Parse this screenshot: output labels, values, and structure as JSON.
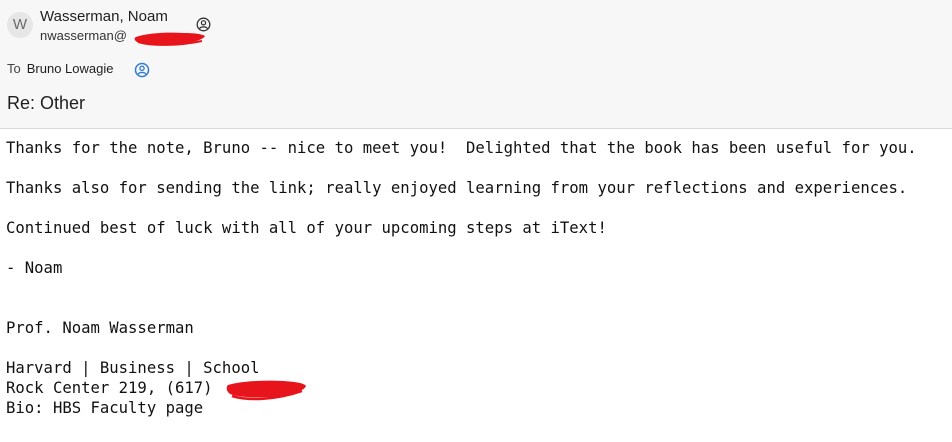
{
  "sender": {
    "avatar_initial": "W",
    "name": "Wasserman, Noam",
    "email_prefix": "nwasserman@"
  },
  "recipient": {
    "to_label": "To",
    "name": "Bruno Lowagie"
  },
  "subject": "Re: Other",
  "body_lines": [
    "Thanks for the note, Bruno -- nice to meet you!  Delighted that the book has been useful for you.",
    "Thanks also for sending the link; really enjoyed learning from your reflections and experiences.",
    "Continued best of luck with all of your upcoming steps at iText!",
    "- Noam",
    "Prof. Noam Wasserman",
    "Harvard | Business | School",
    "Rock Center 219, (617) ",
    "Bio: HBS Faculty page"
  ],
  "colors": {
    "redaction": "#e8141b",
    "contact_icon": "#2f7bd6",
    "header_bg": "#f7f7f7"
  },
  "icons": {
    "presence": "person-circle-icon",
    "contact": "contact-card-icon"
  }
}
